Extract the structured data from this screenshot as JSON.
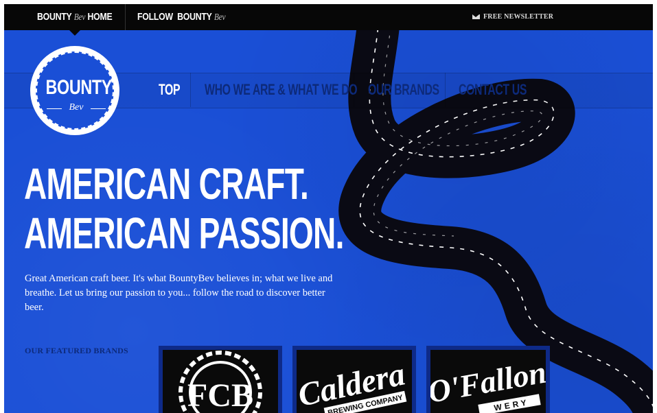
{
  "topbar": {
    "home_brand": "BOUNTY",
    "home_script": "Bev",
    "home_label": "HOME",
    "follow_label": "FOLLOW",
    "follow_brand": "BOUNTY",
    "follow_script": "Bev",
    "newsletter_label": "FREE NEWSLETTER",
    "newsletter_icon": "mail-icon"
  },
  "logo": {
    "main": "BOUNTY",
    "script": "Bev"
  },
  "nav": {
    "items": [
      {
        "label": "TOP",
        "active": true
      },
      {
        "label": "WHO WE ARE & WHAT WE DO",
        "active": false
      },
      {
        "label": "OUR BRANDS",
        "active": false
      },
      {
        "label": "CONTACT US",
        "active": false
      }
    ]
  },
  "hero": {
    "line1": "AMERICAN CRAFT.",
    "line2": "AMERICAN PASSION.",
    "description": "Great American craft beer. It's what BountyBev believes in; what we live and breathe. Let us bring our passion to you... follow the road to discover better beer."
  },
  "featured": {
    "label": "OUR FEATURED BRANDS",
    "brands": [
      {
        "logo_text": "FCB"
      },
      {
        "logo_text": "Caldera",
        "logo_subtext": "BREWING COMPANY"
      },
      {
        "logo_text": "O'Fallon",
        "logo_subtext": "WERY"
      }
    ]
  },
  "colors": {
    "background": "#1a4fd6",
    "topbar": "#070707",
    "nav_text": "#0d2a7a",
    "road": "#0a0a14",
    "road_dash": "#ffffff"
  }
}
